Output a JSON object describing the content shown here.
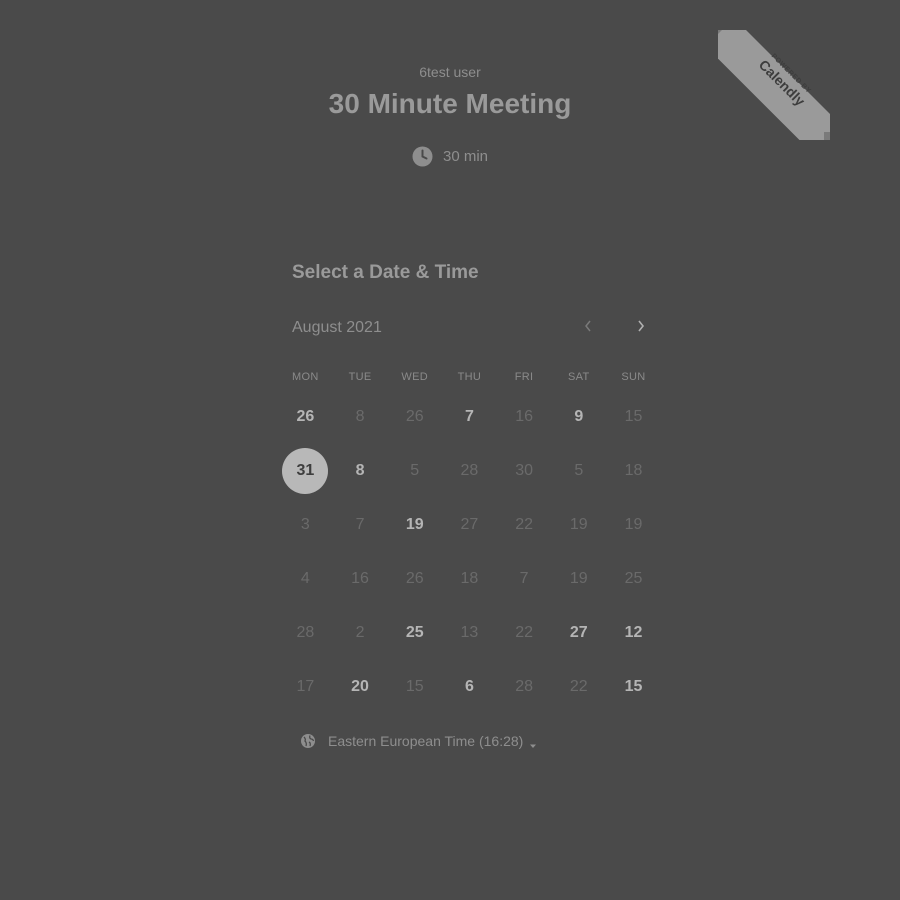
{
  "badge": {
    "powered_by": "POWERED BY",
    "brand": "Calendly"
  },
  "header": {
    "owner": "6test user",
    "title": "30 Minute Meeting",
    "duration": "30 min"
  },
  "calendar": {
    "heading": "Select a Date & Time",
    "month": "August 2021",
    "weekdays": [
      "MON",
      "TUE",
      "WED",
      "THU",
      "FRI",
      "SAT",
      "SUN"
    ],
    "days": [
      {
        "label": "26",
        "available": true
      },
      {
        "label": "8",
        "available": false
      },
      {
        "label": "26",
        "available": false
      },
      {
        "label": "7",
        "available": true
      },
      {
        "label": "16",
        "available": false
      },
      {
        "label": "9",
        "available": true
      },
      {
        "label": "15",
        "available": false
      },
      {
        "label": "31",
        "available": true,
        "selected": true
      },
      {
        "label": "8",
        "available": true
      },
      {
        "label": "5",
        "available": false
      },
      {
        "label": "28",
        "available": false
      },
      {
        "label": "30",
        "available": false
      },
      {
        "label": "5",
        "available": false
      },
      {
        "label": "18",
        "available": false
      },
      {
        "label": "3",
        "available": false
      },
      {
        "label": "7",
        "available": false
      },
      {
        "label": "19",
        "available": true
      },
      {
        "label": "27",
        "available": false
      },
      {
        "label": "22",
        "available": false
      },
      {
        "label": "19",
        "available": false
      },
      {
        "label": "19",
        "available": false
      },
      {
        "label": "4",
        "available": false
      },
      {
        "label": "16",
        "available": false
      },
      {
        "label": "26",
        "available": false
      },
      {
        "label": "18",
        "available": false
      },
      {
        "label": "7",
        "available": false
      },
      {
        "label": "19",
        "available": false
      },
      {
        "label": "25",
        "available": false
      },
      {
        "label": "28",
        "available": false
      },
      {
        "label": "2",
        "available": false
      },
      {
        "label": "25",
        "available": true
      },
      {
        "label": "13",
        "available": false
      },
      {
        "label": "22",
        "available": false
      },
      {
        "label": "27",
        "available": true
      },
      {
        "label": "12",
        "available": true
      },
      {
        "label": "17",
        "available": false
      },
      {
        "label": "20",
        "available": true
      },
      {
        "label": "15",
        "available": false
      },
      {
        "label": "6",
        "available": true
      },
      {
        "label": "28",
        "available": false
      },
      {
        "label": "22",
        "available": false
      },
      {
        "label": "15",
        "available": true
      }
    ]
  },
  "timezone": {
    "label": "Eastern European Time (16:28)"
  },
  "icons": {
    "clock": "clock-icon",
    "globe": "globe-icon",
    "prev": "chevron-left-icon",
    "next": "chevron-right-icon",
    "caret": "caret-down-icon"
  }
}
